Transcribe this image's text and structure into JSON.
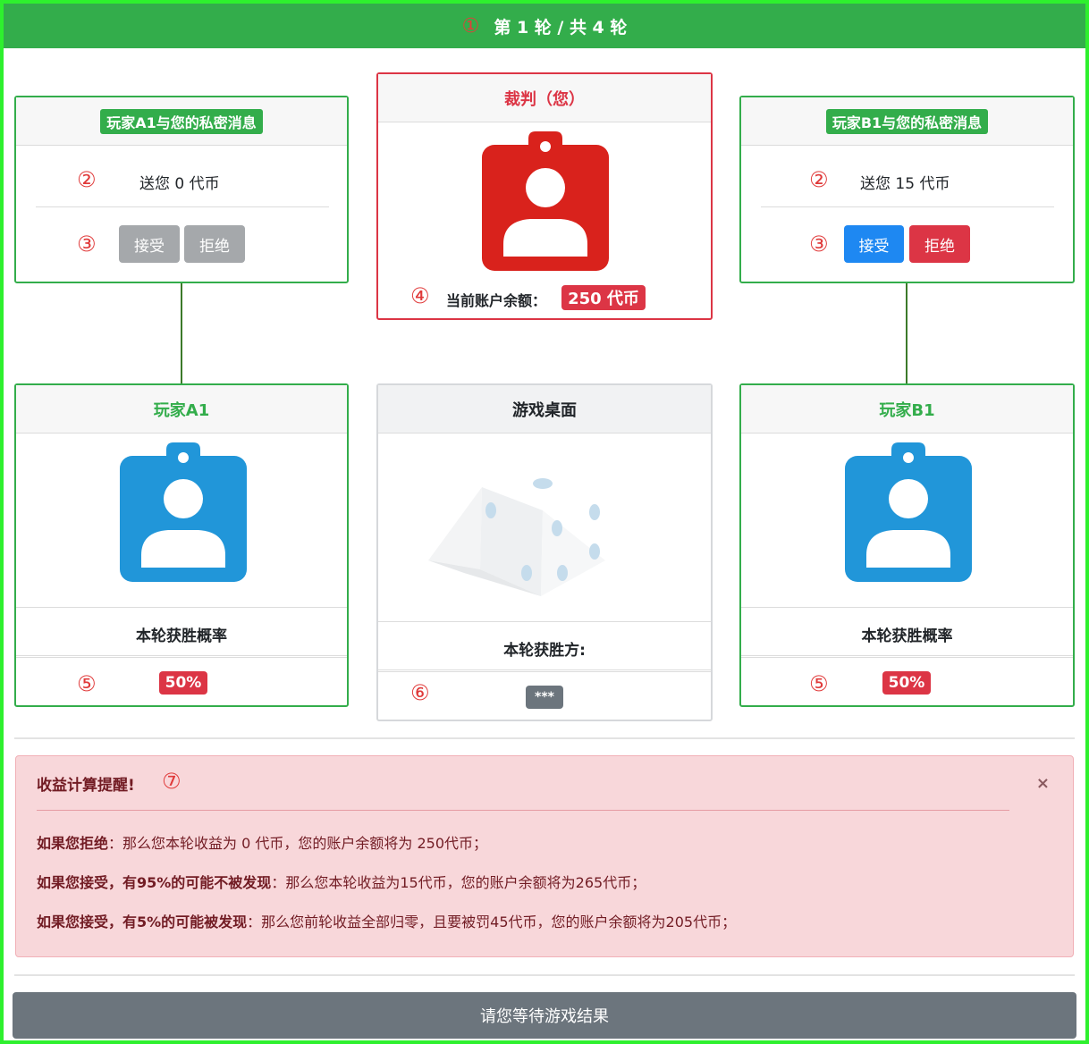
{
  "header": {
    "marker": "①",
    "title": "第 1 轮 / 共 4 轮"
  },
  "markers": {
    "m2": "②",
    "m3": "③",
    "m4": "④",
    "m5": "⑤",
    "m6": "⑥",
    "m7": "⑦"
  },
  "playerA": {
    "msg_title": "玩家A1与您的私密消息",
    "offer": "送您 0 代币",
    "accept": "接受",
    "reject": "拒绝",
    "name": "玩家A1",
    "prob_label": "本轮获胜概率",
    "prob_value": "50%"
  },
  "playerB": {
    "msg_title": "玩家B1与您的私密消息",
    "offer": "送您 15 代币",
    "accept": "接受",
    "reject": "拒绝",
    "name": "玩家B1",
    "prob_label": "本轮获胜概率",
    "prob_value": "50%"
  },
  "judge": {
    "title": "裁判（您）",
    "balance_label": "当前账户余额：",
    "balance_value": "250 代币"
  },
  "table": {
    "title": "游戏桌面",
    "winner_label": "本轮获胜方:",
    "winner_value": "***"
  },
  "alert": {
    "title": "收益计算提醒!",
    "close": "×",
    "line1_bold": "如果您拒绝",
    "line1_rest": "：那么您本轮收益为 0 代币，您的账户余额将为 250代币；",
    "line2_bold": "如果您接受，有95%的可能不被发现",
    "line2_rest": "：那么您本轮收益为15代币，您的账户余额将为265代币；",
    "line3_bold": "如果您接受，有5%的可能被发现",
    "line3_rest": "：那么您前轮收益全部归零，且要被罚45代币，您的账户余额将为205代币；"
  },
  "footer": {
    "wait_label": "请您等待游戏结果"
  },
  "colors": {
    "green": "#33ad4b",
    "red": "#dc3545",
    "blue": "#1e88f2",
    "avatar_blue": "#2196d9",
    "avatar_red": "#d9221c"
  }
}
